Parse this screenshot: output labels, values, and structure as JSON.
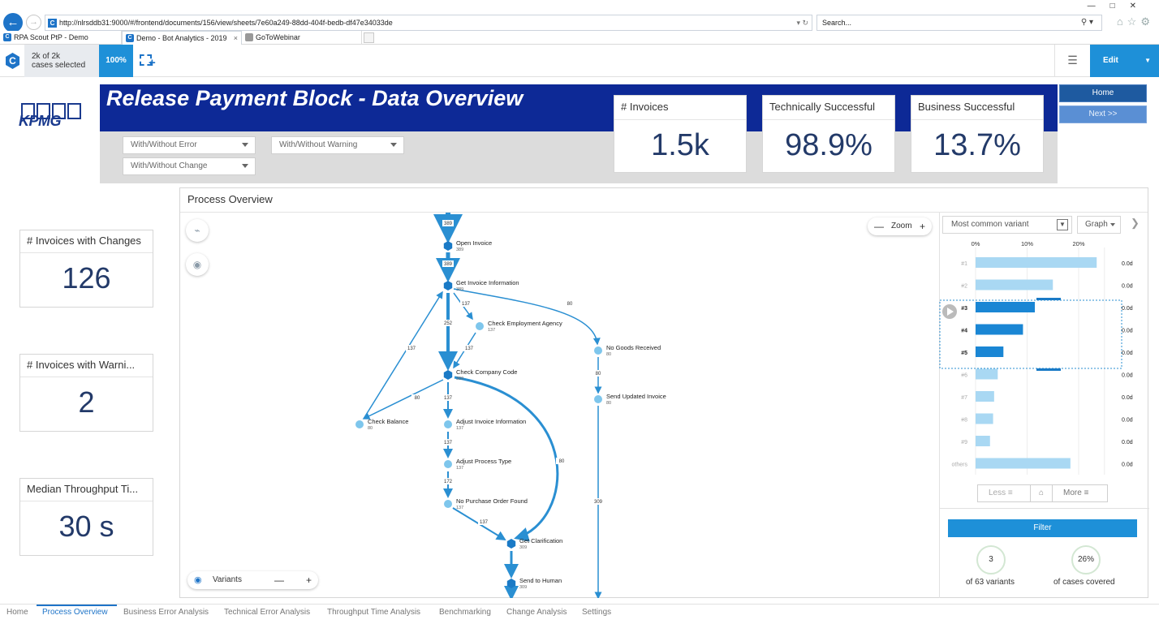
{
  "browser": {
    "url": "http://nlrsddb31:9000/#/frontend/documents/156/view/sheets/7e60a249-88dd-404f-bedb-df47e34033de",
    "search_placeholder": "Search...",
    "tabs": [
      {
        "label": "RPA Scout PtP - Demo"
      },
      {
        "label": "Demo - Bot Analytics - 2019"
      },
      {
        "label": "GoToWebinar"
      }
    ]
  },
  "app": {
    "cases_line1": "2k of 2k",
    "cases_line2": "cases selected",
    "percent": "100%",
    "edit_label": "Edit"
  },
  "sheet": {
    "logo": "KPMG",
    "title": "Release Payment Block - Data Overview",
    "filters": [
      "With/Without Error",
      "With/Without Warning",
      "With/Without Change"
    ],
    "kpis_top": [
      {
        "label": "# Invoices",
        "value": "1.5k"
      },
      {
        "label": "Technically Successful",
        "value": "98.9%"
      },
      {
        "label": "Business Successful",
        "value": "13.7%"
      }
    ],
    "nav": {
      "home": "Home",
      "next": "Next >>"
    },
    "kpis_left": [
      {
        "label": "# Invoices with Changes",
        "value": "126"
      },
      {
        "label": "# Invoices with Warni...",
        "value": "2"
      },
      {
        "label": "Median Throughput Ti...",
        "value": "30 s"
      }
    ]
  },
  "process": {
    "title": "Process Overview",
    "zoom_label": "Zoom",
    "variants_label": "Variants",
    "nodes": [
      {
        "label": "Open Invoice",
        "count": "389"
      },
      {
        "label": "Get Invoice Information",
        "count": "389"
      },
      {
        "label": "Check Employment Agency",
        "count": "137"
      },
      {
        "label": "No Goods Received",
        "count": "80"
      },
      {
        "label": "Check Company Code",
        "count": "389"
      },
      {
        "label": "Send Updated Invoice",
        "count": "80"
      },
      {
        "label": "Check Balance",
        "count": "80"
      },
      {
        "label": "Adjust Invoice Information",
        "count": "137"
      },
      {
        "label": "Adjust Process Type",
        "count": "137"
      },
      {
        "label": "No Purchase Order Found",
        "count": "137"
      },
      {
        "label": "Get Clarification",
        "count": "309"
      },
      {
        "label": "Send to Human",
        "count": "309"
      }
    ],
    "edge_labels": [
      "389",
      "389",
      "137",
      "80",
      "252",
      "137",
      "80",
      "80",
      "137",
      "137",
      "137",
      "172",
      "80",
      "137",
      "309"
    ]
  },
  "variants": {
    "dropdown": "Most common variant",
    "view": "Graph",
    "axis_ticks": [
      "0%",
      "10%",
      "20%"
    ],
    "rows": [
      {
        "label": "#1",
        "value": 23.5,
        "time": "0.0d",
        "selected": false
      },
      {
        "label": "#2",
        "value": 15.0,
        "time": "0.0d",
        "selected": false
      },
      {
        "label": "#3",
        "value": 11.5,
        "time": "0.0d",
        "selected": true
      },
      {
        "label": "#4",
        "value": 9.2,
        "time": "0.0d",
        "selected": true
      },
      {
        "label": "#5",
        "value": 5.4,
        "time": "0.0d",
        "selected": true
      },
      {
        "label": "#6",
        "value": 4.3,
        "time": "0.0d",
        "selected": false
      },
      {
        "label": "#7",
        "value": 3.6,
        "time": "0.0d",
        "selected": false
      },
      {
        "label": "#8",
        "value": 3.4,
        "time": "0.0d",
        "selected": false
      },
      {
        "label": "#9",
        "value": 2.8,
        "time": "0.0d",
        "selected": false
      },
      {
        "label": "others",
        "value": 18.4,
        "time": "0.0d",
        "selected": false
      }
    ],
    "less_label": "Less",
    "more_label": "More",
    "filter_label": "Filter",
    "variant_count": "3",
    "variant_count_label": "of 63 variants",
    "coverage": "26%",
    "coverage_label": "of cases covered"
  },
  "sheet_tabs": [
    "Home",
    "Process Overview",
    "Business Error Analysis",
    "Technical Error Analysis",
    "Throughput Time Analysis",
    "Benchmarking",
    "Change Analysis",
    "Settings"
  ],
  "colors": {
    "accent": "#1e90d8",
    "brand": "#0d2996",
    "node_dark": "#1a7ac6",
    "node_light": "#7ec6ec"
  }
}
